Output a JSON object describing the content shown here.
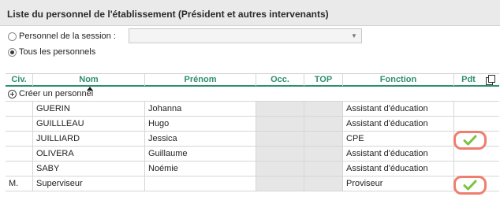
{
  "panel": {
    "title": "Liste du personnel de l'établissement (Président et autres intervenants)"
  },
  "filters": {
    "option_session_label": "Personnel de la session :",
    "option_session_selected": false,
    "option_all_label": "Tous les personnels",
    "option_all_selected": true,
    "session_select_value": ""
  },
  "table": {
    "columns": [
      "Civ.",
      "Nom",
      "Prénom",
      "Occ.",
      "TOP",
      "Fonction",
      "Pdt"
    ],
    "sorted_column": "Nom",
    "create_label": "Créer un personnel",
    "rows": [
      {
        "civ": "",
        "nom": "GUERIN",
        "prenom": "Johanna",
        "occ": "",
        "top": "",
        "fonction": "Assistant d'éducation",
        "pdt": false
      },
      {
        "civ": "",
        "nom": "GUILLLEAU",
        "prenom": "Hugo",
        "occ": "",
        "top": "",
        "fonction": "Assistant d'éducation",
        "pdt": false
      },
      {
        "civ": "",
        "nom": "JUILLIARD",
        "prenom": "Jessica",
        "occ": "",
        "top": "",
        "fonction": "CPE",
        "pdt": true
      },
      {
        "civ": "",
        "nom": "OLIVERA",
        "prenom": "Guillaume",
        "occ": "",
        "top": "",
        "fonction": "Assistant d'éducation",
        "pdt": false
      },
      {
        "civ": "",
        "nom": "SABY",
        "prenom": "Noémie",
        "occ": "",
        "top": "",
        "fonction": "Assistant d'éducation",
        "pdt": false
      },
      {
        "civ": "M.",
        "nom": "Superviseur",
        "prenom": "",
        "occ": "",
        "top": "",
        "fonction": "Proviseur",
        "pdt": true
      }
    ]
  },
  "colors": {
    "accent_green": "#2e8f6c",
    "check_green": "#7cc242",
    "highlight_border": "#f07e6e"
  },
  "icons": {
    "copy": "copy-icon",
    "create": "plus-circle-icon",
    "pdt_check": "checkmark-icon",
    "select_arrow": "chevron-down-icon"
  }
}
